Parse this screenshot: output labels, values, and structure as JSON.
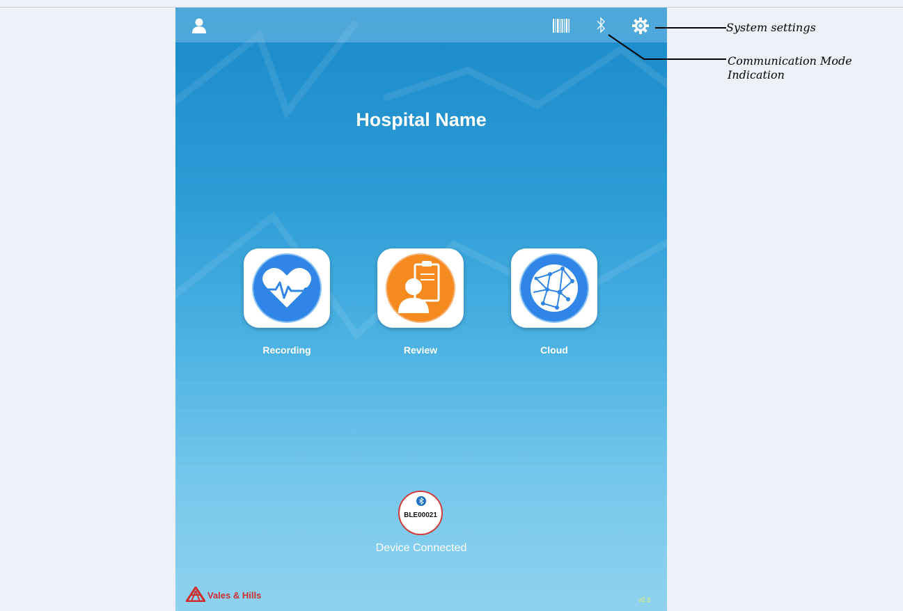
{
  "screen": {
    "title": "Hospital Name",
    "status_bar": {
      "icons": [
        "user-icon",
        "barcode-icon",
        "bluetooth-icon",
        "gear-icon"
      ]
    },
    "apps": [
      {
        "label": "Recording",
        "icon": "heart-ecg-icon",
        "color": "#2f86e6"
      },
      {
        "label": "Review",
        "icon": "clipboard-user-icon",
        "color": "#f58a1f"
      },
      {
        "label": "Cloud",
        "icon": "network-globe-icon",
        "color": "#2f86e6"
      }
    ],
    "device": {
      "id": "BLE00021",
      "status": "Device Connected",
      "icon": "bluetooth-icon"
    },
    "brand": "Vales & Hills",
    "version": "v2.3"
  },
  "annotations": {
    "system_settings": "System settings",
    "communication_line1": "Communication Mode",
    "communication_line2": "Indication"
  },
  "colors": {
    "accent_blue": "#2f86e6",
    "accent_orange": "#f58a1f",
    "brand_red": "#cd2f2f",
    "version_yellow": "#e8f25a"
  }
}
